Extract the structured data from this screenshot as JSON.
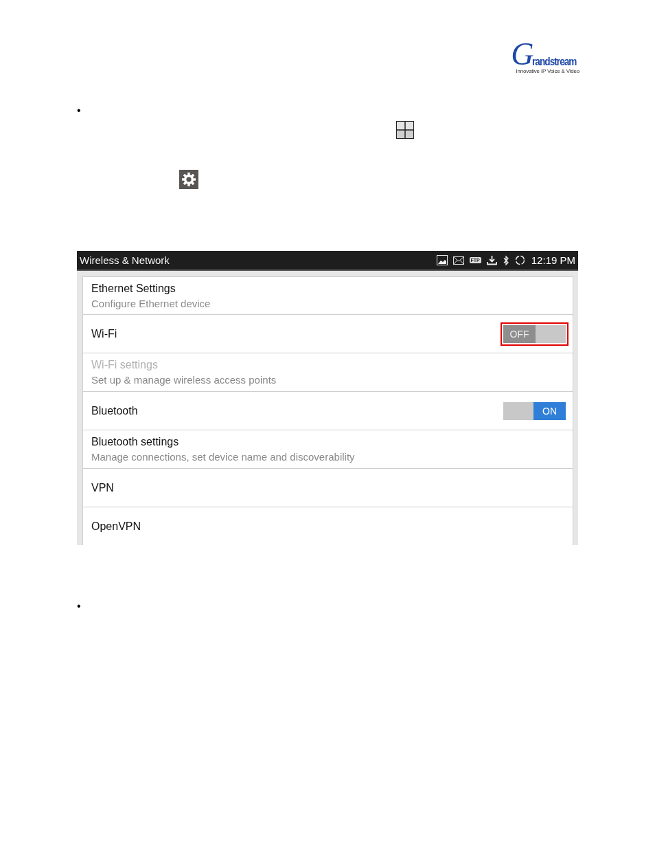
{
  "logo": {
    "initial": "G",
    "rest": "randstream",
    "tagline": "Innovative IP Voice & Video"
  },
  "bullets": [
    "•",
    "•"
  ],
  "screen": {
    "title": "Wireless & Network",
    "time": "12:19 PM",
    "ftp_label": "FTP",
    "rows": [
      {
        "kind": "item",
        "title": "Ethernet Settings",
        "subtitle": "Configure Ethernet device",
        "disabled": false
      },
      {
        "kind": "toggle",
        "title": "Wi-Fi",
        "label": "OFF",
        "on": false,
        "highlighted": true
      },
      {
        "kind": "item",
        "title": "Wi-Fi settings",
        "subtitle": "Set up & manage wireless access points",
        "disabled": true
      },
      {
        "kind": "toggle",
        "title": "Bluetooth",
        "label": "ON",
        "on": true,
        "highlighted": false
      },
      {
        "kind": "item",
        "title": "Bluetooth settings",
        "subtitle": "Manage connections, set device name and discoverability",
        "disabled": false
      },
      {
        "kind": "item",
        "title": "VPN",
        "disabled": false
      },
      {
        "kind": "item",
        "title": "OpenVPN",
        "disabled": false
      }
    ]
  }
}
